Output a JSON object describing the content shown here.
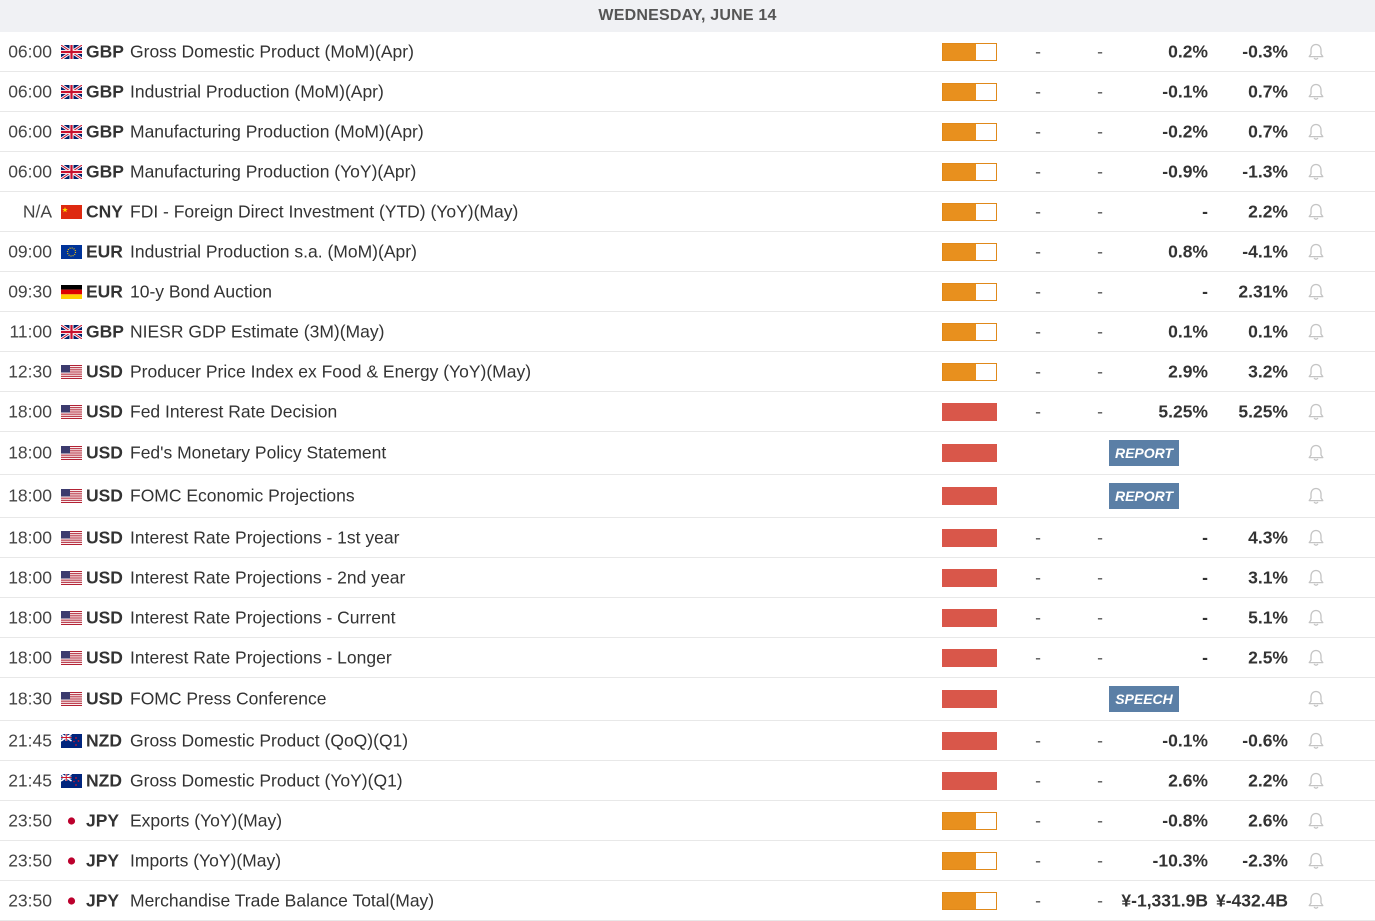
{
  "day_header": "WEDNESDAY, JUNE 14",
  "colors": {
    "medium_importance": "#e8901e",
    "high_importance": "#d9574a",
    "badge": "#5b7fa6",
    "header_bg": "#f0f1f4"
  },
  "events": [
    {
      "time": "06:00",
      "flag": "gb",
      "currency": "GBP",
      "name": "Gross Domestic Product (MoM)(Apr)",
      "importance": "medium",
      "actual": "-",
      "consensus": "-",
      "forecast": "0.2%",
      "previous": "-0.3%"
    },
    {
      "time": "06:00",
      "flag": "gb",
      "currency": "GBP",
      "name": "Industrial Production (MoM)(Apr)",
      "importance": "medium",
      "actual": "-",
      "consensus": "-",
      "forecast": "-0.1%",
      "previous": "0.7%"
    },
    {
      "time": "06:00",
      "flag": "gb",
      "currency": "GBP",
      "name": "Manufacturing Production (MoM)(Apr)",
      "importance": "medium",
      "actual": "-",
      "consensus": "-",
      "forecast": "-0.2%",
      "previous": "0.7%"
    },
    {
      "time": "06:00",
      "flag": "gb",
      "currency": "GBP",
      "name": "Manufacturing Production (YoY)(Apr)",
      "importance": "medium",
      "actual": "-",
      "consensus": "-",
      "forecast": "-0.9%",
      "previous": "-1.3%"
    },
    {
      "time": "N/A",
      "flag": "cn",
      "currency": "CNY",
      "name": "FDI - Foreign Direct Investment (YTD) (YoY)(May)",
      "importance": "medium",
      "actual": "-",
      "consensus": "-",
      "forecast": "-",
      "previous": "2.2%"
    },
    {
      "time": "09:00",
      "flag": "eu",
      "currency": "EUR",
      "name": "Industrial Production s.a. (MoM)(Apr)",
      "importance": "medium",
      "actual": "-",
      "consensus": "-",
      "forecast": "0.8%",
      "previous": "-4.1%"
    },
    {
      "time": "09:30",
      "flag": "de",
      "currency": "EUR",
      "name": "10-y Bond Auction",
      "importance": "medium",
      "actual": "-",
      "consensus": "-",
      "forecast": "-",
      "previous": "2.31%"
    },
    {
      "time": "11:00",
      "flag": "gb",
      "currency": "GBP",
      "name": "NIESR GDP Estimate (3M)(May)",
      "importance": "medium",
      "actual": "-",
      "consensus": "-",
      "forecast": "0.1%",
      "previous": "0.1%"
    },
    {
      "time": "12:30",
      "flag": "us",
      "currency": "USD",
      "name": "Producer Price Index ex Food & Energy (YoY)(May)",
      "importance": "medium",
      "actual": "-",
      "consensus": "-",
      "forecast": "2.9%",
      "previous": "3.2%"
    },
    {
      "time": "18:00",
      "flag": "us",
      "currency": "USD",
      "name": "Fed Interest Rate Decision",
      "importance": "high",
      "actual": "-",
      "consensus": "-",
      "forecast": "5.25%",
      "previous": "5.25%"
    },
    {
      "time": "18:00",
      "flag": "us",
      "currency": "USD",
      "name": "Fed's Monetary Policy Statement",
      "importance": "high",
      "tag": "REPORT"
    },
    {
      "time": "18:00",
      "flag": "us",
      "currency": "USD",
      "name": "FOMC Economic Projections",
      "importance": "high",
      "tag": "REPORT"
    },
    {
      "time": "18:00",
      "flag": "us",
      "currency": "USD",
      "name": "Interest Rate Projections - 1st year",
      "importance": "high",
      "actual": "-",
      "consensus": "-",
      "forecast": "-",
      "previous": "4.3%"
    },
    {
      "time": "18:00",
      "flag": "us",
      "currency": "USD",
      "name": "Interest Rate Projections - 2nd year",
      "importance": "high",
      "actual": "-",
      "consensus": "-",
      "forecast": "-",
      "previous": "3.1%"
    },
    {
      "time": "18:00",
      "flag": "us",
      "currency": "USD",
      "name": "Interest Rate Projections - Current",
      "importance": "high",
      "actual": "-",
      "consensus": "-",
      "forecast": "-",
      "previous": "5.1%"
    },
    {
      "time": "18:00",
      "flag": "us",
      "currency": "USD",
      "name": "Interest Rate Projections - Longer",
      "importance": "high",
      "actual": "-",
      "consensus": "-",
      "forecast": "-",
      "previous": "2.5%"
    },
    {
      "time": "18:30",
      "flag": "us",
      "currency": "USD",
      "name": "FOMC Press Conference",
      "importance": "high",
      "tag": "SPEECH"
    },
    {
      "time": "21:45",
      "flag": "nz",
      "currency": "NZD",
      "name": "Gross Domestic Product (QoQ)(Q1)",
      "importance": "high",
      "actual": "-",
      "consensus": "-",
      "forecast": "-0.1%",
      "previous": "-0.6%"
    },
    {
      "time": "21:45",
      "flag": "nz",
      "currency": "NZD",
      "name": "Gross Domestic Product (YoY)(Q1)",
      "importance": "high",
      "actual": "-",
      "consensus": "-",
      "forecast": "2.6%",
      "previous": "2.2%"
    },
    {
      "time": "23:50",
      "flag": "jp",
      "currency": "JPY",
      "name": "Exports (YoY)(May)",
      "importance": "medium",
      "actual": "-",
      "consensus": "-",
      "forecast": "-0.8%",
      "previous": "2.6%"
    },
    {
      "time": "23:50",
      "flag": "jp",
      "currency": "JPY",
      "name": "Imports (YoY)(May)",
      "importance": "medium",
      "actual": "-",
      "consensus": "-",
      "forecast": "-10.3%",
      "previous": "-2.3%"
    },
    {
      "time": "23:50",
      "flag": "jp",
      "currency": "JPY",
      "name": "Merchandise Trade Balance Total(May)",
      "importance": "medium",
      "actual": "-",
      "consensus": "-",
      "forecast": "¥-1,331.9B",
      "previous": "¥-432.4B"
    }
  ]
}
